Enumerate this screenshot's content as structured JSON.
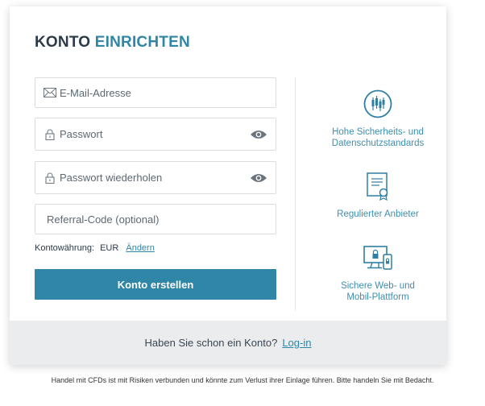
{
  "header": {
    "title_part1": "KONTO",
    "title_part2": "EINRICHTEN"
  },
  "form": {
    "email": {
      "placeholder": "E-Mail-Adresse",
      "value": "",
      "icon": "envelope-icon"
    },
    "password": {
      "placeholder": "Passwort",
      "value": "",
      "icon": "lock-icon",
      "toggle_icon": "eye-icon"
    },
    "password_repeat": {
      "placeholder": "Passwort wiederholen",
      "value": "",
      "icon": "lock-icon",
      "toggle_icon": "eye-icon"
    },
    "referral": {
      "placeholder": "Referral-Code (optional)",
      "value": ""
    },
    "currency": {
      "label": "Kontowährung:",
      "value": "EUR",
      "change_label": "Ändern"
    },
    "submit_label": "Konto erstellen"
  },
  "features": [
    {
      "icon": "candlestick-chart-icon",
      "text_line1": "Hohe Sicherheits- und",
      "text_line2": "Datenschutzstandards"
    },
    {
      "icon": "certificate-icon",
      "text_line1": "Regulierter Anbieter",
      "text_line2": ""
    },
    {
      "icon": "devices-lock-icon",
      "text_line1": "Sichere Web- und",
      "text_line2": "Mobil-Plattform"
    }
  ],
  "footer": {
    "prompt": "Haben Sie schon ein Konto?",
    "login_label": "Log-in"
  },
  "disclaimer": "Handel mit CFDs ist mit Risiken verbunden und könnte zum Verlust ihrer Einlage führen. Bitte handeln Sie mit Bedacht.",
  "colors": {
    "accent": "#2f86a6",
    "title_dark": "#2b3b49",
    "footer_bg": "#eaecee",
    "feature_text": "#3d8fb0"
  }
}
